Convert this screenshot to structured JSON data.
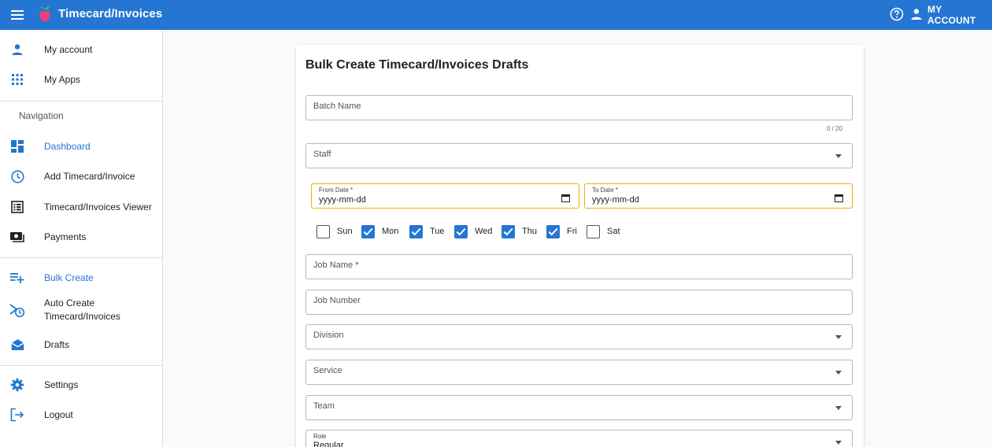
{
  "header": {
    "title": "Timecard/Invoices",
    "account_label": "MY ACCOUNT",
    "menu_icon": "hamburger-menu-icon",
    "help_icon": "help-circle-icon",
    "account_icon": "person-icon"
  },
  "sidebar": {
    "top_items": [
      {
        "label": "My account",
        "icon": "person-icon"
      },
      {
        "label": "My Apps",
        "icon": "apps-grid-icon"
      }
    ],
    "section_title": "Navigation",
    "nav_items": [
      {
        "label": "Dashboard",
        "icon": "dashboard-icon",
        "active": true
      },
      {
        "label": "Add Timecard/Invoice",
        "icon": "clock-icon"
      },
      {
        "label": "Timecard/Invoices Viewer",
        "icon": "list-icon"
      },
      {
        "label": "Payments",
        "icon": "money-icon"
      }
    ],
    "bulk_items": [
      {
        "label": "Bulk Create",
        "icon": "playlist-add-icon",
        "active": true
      },
      {
        "label_line1": "Auto Create",
        "label_line2": "Timecard/Invoices",
        "icon": "auto-schedule-icon"
      },
      {
        "label": "Drafts",
        "icon": "drafts-icon"
      }
    ],
    "bottom_items": [
      {
        "label": "Settings",
        "icon": "gear-icon"
      },
      {
        "label": "Logout",
        "icon": "logout-icon"
      }
    ]
  },
  "form": {
    "title": "Bulk Create Timecard/Invoices Drafts",
    "batch_name": {
      "label": "Batch Name",
      "counter": "0 / 20"
    },
    "staff": {
      "label": "Staff"
    },
    "from_date": {
      "label": "From Date *",
      "value": "yyyy-mm-dd"
    },
    "to_date": {
      "label": "To Date *",
      "value": "yyyy-mm-dd"
    },
    "days": [
      {
        "label": "Sun",
        "checked": false
      },
      {
        "label": "Mon",
        "checked": true
      },
      {
        "label": "Tue",
        "checked": true
      },
      {
        "label": "Wed",
        "checked": true
      },
      {
        "label": "Thu",
        "checked": true
      },
      {
        "label": "Fri",
        "checked": true
      },
      {
        "label": "Sat",
        "checked": false
      }
    ],
    "job_name": {
      "label": "Job Name *"
    },
    "job_number": {
      "label": "Job Number"
    },
    "division": {
      "label": "Division"
    },
    "service": {
      "label": "Service"
    },
    "team": {
      "label": "Team"
    },
    "role": {
      "label": "Role",
      "value": "Regular"
    }
  },
  "colors": {
    "primary": "#2576d2",
    "date_outline": "#e8b400"
  }
}
